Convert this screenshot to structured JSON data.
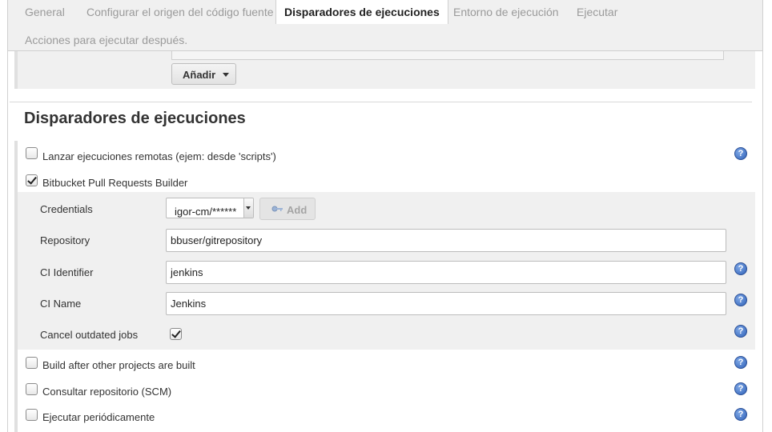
{
  "tabs": [
    {
      "label": "General"
    },
    {
      "label": "Configurar el origen del código fuente"
    },
    {
      "label": "Disparadores de ejecuciones",
      "active": true
    },
    {
      "label": "Entorno de ejecución"
    },
    {
      "label": "Ejecutar"
    },
    {
      "label": "Acciones para ejecutar después."
    }
  ],
  "prev_section": {
    "add_button_label": "Añadir"
  },
  "section": {
    "title": "Disparadores de ejecuciones"
  },
  "triggers": {
    "remote": {
      "label": "Lanzar ejecuciones remotas (ejem: desde 'scripts')",
      "checked": false
    },
    "bitbucket": {
      "label": "Bitbucket Pull Requests Builder",
      "checked": true
    },
    "build_after": {
      "label": "Build after other projects are built",
      "checked": false
    },
    "scm": {
      "label": "Consultar repositorio (SCM)",
      "checked": false
    },
    "periodic": {
      "label": "Ejecutar periódicamente",
      "checked": false
    }
  },
  "bitbucket_options": {
    "credentials": {
      "label": "Credentials",
      "selected": "igor-cm/******",
      "add_label": "Add"
    },
    "repository": {
      "label": "Repository",
      "value": "bbuser/gitrepository"
    },
    "ci_identifier": {
      "label": "CI Identifier",
      "value": "jenkins"
    },
    "ci_name": {
      "label": "CI Name",
      "value": "Jenkins"
    },
    "cancel_outdated": {
      "label": "Cancel outdated jobs",
      "checked": true
    }
  },
  "colors": {
    "accent_help": "#2f61b8",
    "panel_bg": "#f0f0f0",
    "rail": "#e0e0e0"
  },
  "icons": {
    "help": "help-icon",
    "key": "key-icon",
    "dropdown": "caret-down-icon"
  }
}
